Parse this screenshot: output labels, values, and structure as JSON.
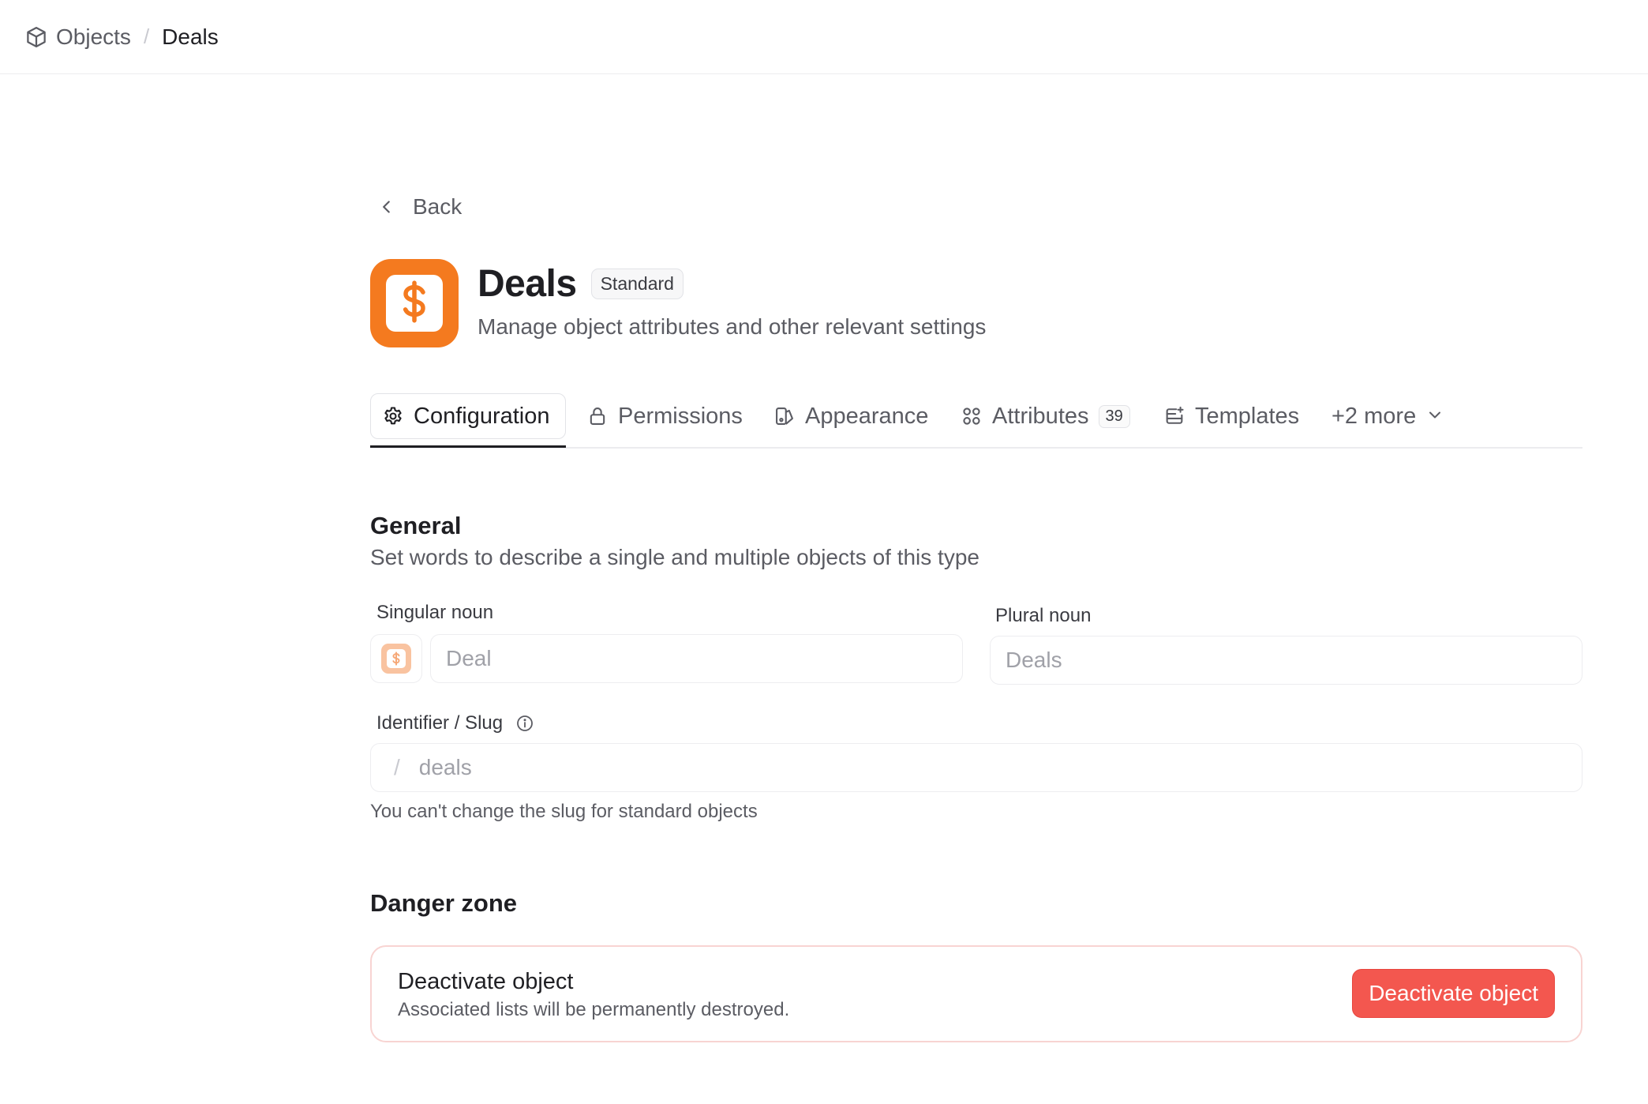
{
  "breadcrumb": {
    "parent": "Objects",
    "separator": "/",
    "current": "Deals"
  },
  "back": {
    "label": "Back"
  },
  "object": {
    "title": "Deals",
    "badge": "Standard",
    "subtitle": "Manage object attributes and other relevant settings",
    "icon": "dollar-sign-icon",
    "color": "#f47a1f"
  },
  "tabs": [
    {
      "label": "Configuration",
      "icon": "gear-icon",
      "active": true
    },
    {
      "label": "Permissions",
      "icon": "lock-icon"
    },
    {
      "label": "Appearance",
      "icon": "palette-icon"
    },
    {
      "label": "Attributes",
      "icon": "attributes-grid-icon",
      "count": "39"
    },
    {
      "label": "Templates",
      "icon": "templates-icon"
    },
    {
      "label": "+2 more",
      "icon": "chevron-down-icon"
    }
  ],
  "general": {
    "title": "General",
    "subtitle": "Set words to describe a single and multiple objects of this type",
    "singular_label": "Singular noun",
    "singular_value": "Deal",
    "plural_label": "Plural noun",
    "plural_value": "Deals",
    "slug_label": "Identifier / Slug",
    "slug_prefix": "/",
    "slug_value": "deals",
    "slug_hint": "You can't change the slug for standard objects"
  },
  "danger": {
    "title": "Danger zone",
    "card_title": "Deactivate object",
    "card_subtitle": "Associated lists will be permanently destroyed.",
    "button_label": "Deactivate object",
    "button_color": "#f3574f"
  }
}
